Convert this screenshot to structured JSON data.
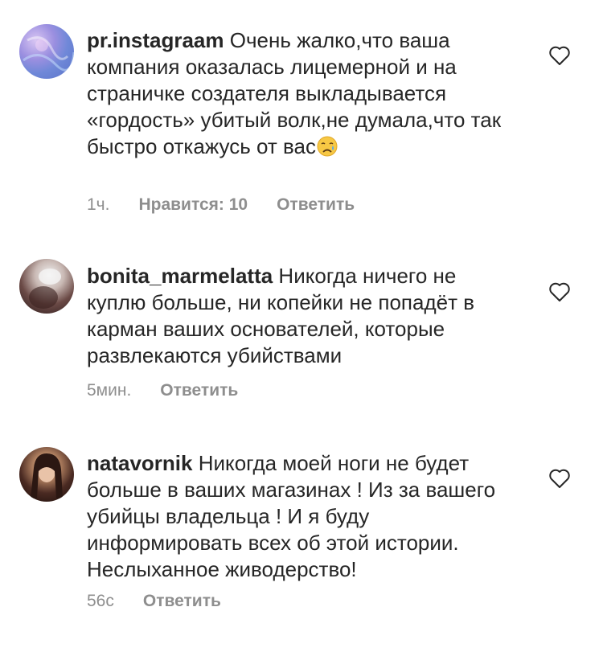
{
  "comments": [
    {
      "username": "pr.instagraam",
      "text_before_emoji": "Очень жалко,что ваша компания оказалась лицемерной и на страничке создателя выкладывается «гордость» убитый волк,не думала,что так быстро откажусь от вас",
      "emoji": "crying-face",
      "time": "1ч.",
      "likes": "Нравится: 10",
      "reply": "Ответить"
    },
    {
      "username": "bonita_marmelatta",
      "text": "Никогда ничего не куплю больше, ни копейки не попадёт в карман ваших основателей, которые развлекаются убийствами",
      "time": "5мин.",
      "reply": "Ответить"
    },
    {
      "username": "natavornik",
      "text": "Никогда моей ноги не будет больше в ваших магазинах ! Из за вашего убийцы владельца ! И я буду информировать всех об этой истории. Неслыханное живодерство!",
      "time": "56с",
      "reply": "Ответить"
    }
  ],
  "colors": {
    "text": "#262626",
    "meta": "#8e8e8e",
    "icon": "#262626"
  }
}
